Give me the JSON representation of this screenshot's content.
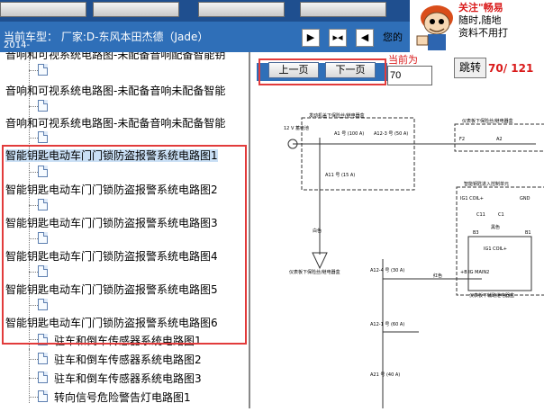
{
  "header": {
    "vehicle_prefix": "当前车型：",
    "vehicle": "厂家:D-东风本田杰德（Jade）",
    "vehicle_year": "2014-",
    "notice": "您的",
    "controls": [
      "fit-page",
      "split",
      "arrow-left"
    ]
  },
  "promo": {
    "line1": "关注\"畅易",
    "line2": "随时,随地",
    "line3": "资料不用打"
  },
  "tree": {
    "items": [
      {
        "label": "音响和可视系统电路图-未配备音响配备智能钥"
      },
      {
        "label": "音响和可视系统电路图-未配备音响未配备智能"
      },
      {
        "label": "音响和可视系统电路图-未配备音响未配备智能"
      },
      {
        "label": "智能钥匙电动车门门锁防盗报警系统电路图1"
      },
      {
        "label": "智能钥匙电动车门门锁防盗报警系统电路图2"
      },
      {
        "label": "智能钥匙电动车门门锁防盗报警系统电路图3"
      },
      {
        "label": "智能钥匙电动车门门锁防盗报警系统电路图4"
      },
      {
        "label": "智能钥匙电动车门门锁防盗报警系统电路图5"
      },
      {
        "label": "智能钥匙电动车门门锁防盗报警系统电路图6"
      }
    ],
    "sub_items": [
      {
        "label": "驻车和倒车传感器系统电路图1"
      },
      {
        "label": "驻车和倒车传感器系统电路图2"
      },
      {
        "label": "驻车和倒车传感器系统电路图3"
      },
      {
        "label": "转向信号危险警告灯电路图1"
      }
    ]
  },
  "nav": {
    "prev_label": "上一页",
    "next_label": "下一页",
    "current_label": "当前为",
    "current_page": "70",
    "jump_label": "跳转",
    "page_count": "70/ 121"
  },
  "diagram": {
    "labels": [
      "发动机盖下保险丝/继电器盒",
      "仪表板下保险丝/继电器盒",
      "12 V 蓄电池",
      "A1 号 (100 A)",
      "A12-3 号 (50 A)",
      "A11 号 (15 A)",
      "白色",
      "F2",
      "A2",
      "智能钥匙进入控制单元",
      "IG1 COIL+",
      "GND",
      "C11",
      "C1",
      "B3",
      "B1",
      "IG1 COIL+",
      "+B IG MAIN2",
      "A12-4 号 (30 A)",
      "红色",
      "A12-1 号 (60 A)",
      "A21 号 (40 A)",
      "仪表板下保险丝/继电器盒",
      "仪表板下辅助继电器盒",
      "黑色"
    ]
  },
  "colors": {
    "accent": "#2f6fb8",
    "highlight_border": "#e23b3b",
    "red_text": "#d91a1a"
  }
}
